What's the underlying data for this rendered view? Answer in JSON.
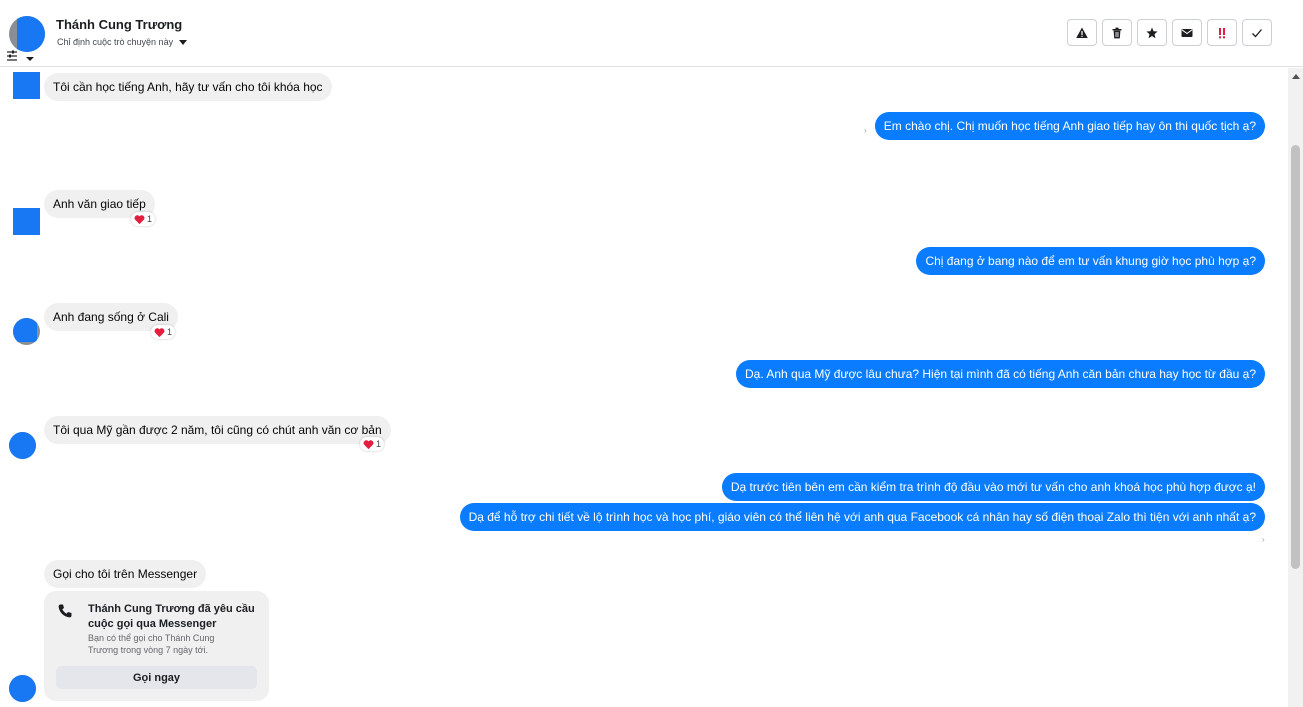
{
  "header": {
    "contact_name": "Thánh Cung Trương",
    "assign_label": "Chỉ định cuộc trò chuyện này"
  },
  "toolbar": {
    "buttons": [
      {
        "name": "spam-button",
        "icon": "warning-icon"
      },
      {
        "name": "delete-button",
        "icon": "trash-icon"
      },
      {
        "name": "star-button",
        "icon": "star-icon"
      },
      {
        "name": "mark-unread-button",
        "icon": "envelope-icon"
      },
      {
        "name": "follow-up-button",
        "icon": "exclamation-icon",
        "color": "#e41e3f"
      },
      {
        "name": "done-button",
        "icon": "check-icon"
      }
    ]
  },
  "messages": [
    {
      "dir": "in",
      "text": "Tôi cần học tiếng Anh, hãy tư vấn cho tôi khóa học"
    },
    {
      "dir": "out",
      "text": "Em chào chị. Chị muốn học tiếng Anh giao tiếp hay ôn thi quốc tịch ạ?"
    },
    {
      "dir": "in",
      "text": "Anh văn giao tiếp",
      "reaction_count": "1"
    },
    {
      "dir": "out",
      "text": "Chị đang ở bang nào để em tư vấn khung giờ học phù hợp ạ?"
    },
    {
      "dir": "in",
      "text": "Anh đang sống ở Cali",
      "reaction_count": "1"
    },
    {
      "dir": "out",
      "text": "Dạ. Anh qua Mỹ được lâu chưa? Hiện tại mình đã có tiếng Anh căn bản chưa hay học từ đầu ạ?"
    },
    {
      "dir": "in",
      "text": "Tôi qua Mỹ gần được 2 năm, tôi cũng có chút anh văn cơ bản",
      "reaction_count": "1"
    },
    {
      "dir": "out",
      "text": "Dạ trước tiên bên em cần kiểm tra trình độ đầu vào mới tư vấn cho anh khoá học phù hợp được ạ!"
    },
    {
      "dir": "out",
      "text": "Dạ để hỗ trợ chi tiết về lộ trình học và học phí, giáo viên có thể liên hệ với anh qua Facebook cá nhân hay số điện thoại Zalo thì tiện với anh nhất ạ?"
    },
    {
      "dir": "in",
      "text": "Gọi cho tôi trên Messenger"
    }
  ],
  "call_request": {
    "title": "Thánh Cung Trương đã yêu cầu cuộc gọi qua Messenger",
    "subtitle": "Bạn có thể gọi cho Thánh Cung Trương trong vòng 7 ngày tới.",
    "button_label": "Gọi ngay"
  },
  "colors": {
    "outgoing": "#0a7cff",
    "incoming": "#f0f0f0",
    "accent": "#1877f2",
    "reaction_heart": "#e41e3f"
  }
}
